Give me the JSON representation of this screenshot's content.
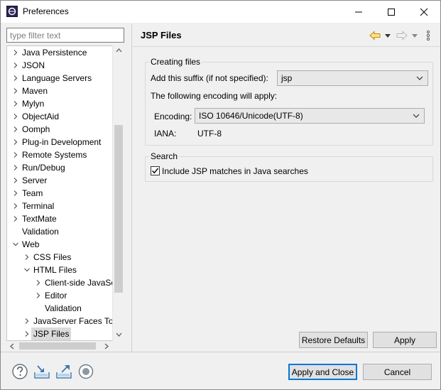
{
  "window": {
    "title": "Preferences"
  },
  "filter": {
    "placeholder": "type filter text"
  },
  "tree": {
    "items": [
      {
        "label": "Java Persistence",
        "level": 0,
        "twisty": "collapsed"
      },
      {
        "label": "JSON",
        "level": 0,
        "twisty": "collapsed"
      },
      {
        "label": "Language Servers",
        "level": 0,
        "twisty": "collapsed"
      },
      {
        "label": "Maven",
        "level": 0,
        "twisty": "collapsed"
      },
      {
        "label": "Mylyn",
        "level": 0,
        "twisty": "collapsed"
      },
      {
        "label": "ObjectAid",
        "level": 0,
        "twisty": "collapsed"
      },
      {
        "label": "Oomph",
        "level": 0,
        "twisty": "collapsed"
      },
      {
        "label": "Plug-in Development",
        "level": 0,
        "twisty": "collapsed"
      },
      {
        "label": "Remote Systems",
        "level": 0,
        "twisty": "collapsed"
      },
      {
        "label": "Run/Debug",
        "level": 0,
        "twisty": "collapsed"
      },
      {
        "label": "Server",
        "level": 0,
        "twisty": "collapsed"
      },
      {
        "label": "Team",
        "level": 0,
        "twisty": "collapsed"
      },
      {
        "label": "Terminal",
        "level": 0,
        "twisty": "collapsed"
      },
      {
        "label": "TextMate",
        "level": 0,
        "twisty": "collapsed"
      },
      {
        "label": "Validation",
        "level": 0,
        "twisty": "none"
      },
      {
        "label": "Web",
        "level": 0,
        "twisty": "expanded"
      },
      {
        "label": "CSS Files",
        "level": 1,
        "twisty": "collapsed"
      },
      {
        "label": "HTML Files",
        "level": 1,
        "twisty": "expanded"
      },
      {
        "label": "Client-side JavaSc",
        "level": 2,
        "twisty": "collapsed"
      },
      {
        "label": "Editor",
        "level": 2,
        "twisty": "collapsed"
      },
      {
        "label": "Validation",
        "level": 2,
        "twisty": "none"
      },
      {
        "label": "JavaServer Faces Too",
        "level": 1,
        "twisty": "collapsed"
      },
      {
        "label": "JSP Files",
        "level": 1,
        "twisty": "collapsed",
        "selected": true
      }
    ]
  },
  "page": {
    "title": "JSP Files",
    "creating_files": {
      "group_title": "Creating files",
      "suffix_label": "Add this suffix (if not specified):",
      "suffix_value": "jsp",
      "encoding_note": "The following encoding will apply:",
      "encoding_label": "Encoding:",
      "encoding_value": "ISO 10646/Unicode(UTF-8)",
      "iana_label": "IANA:",
      "iana_value": "UTF-8"
    },
    "search": {
      "group_title": "Search",
      "checkbox_label": "Include JSP matches in Java searches",
      "checked": true
    },
    "restore_defaults": "Restore Defaults",
    "apply": "Apply"
  },
  "footer": {
    "apply_and_close": "Apply and Close",
    "cancel": "Cancel"
  },
  "colors": {
    "accent": "#0078d7",
    "nav_back": "#e8a000",
    "help_icon": "#1e6fb3"
  }
}
